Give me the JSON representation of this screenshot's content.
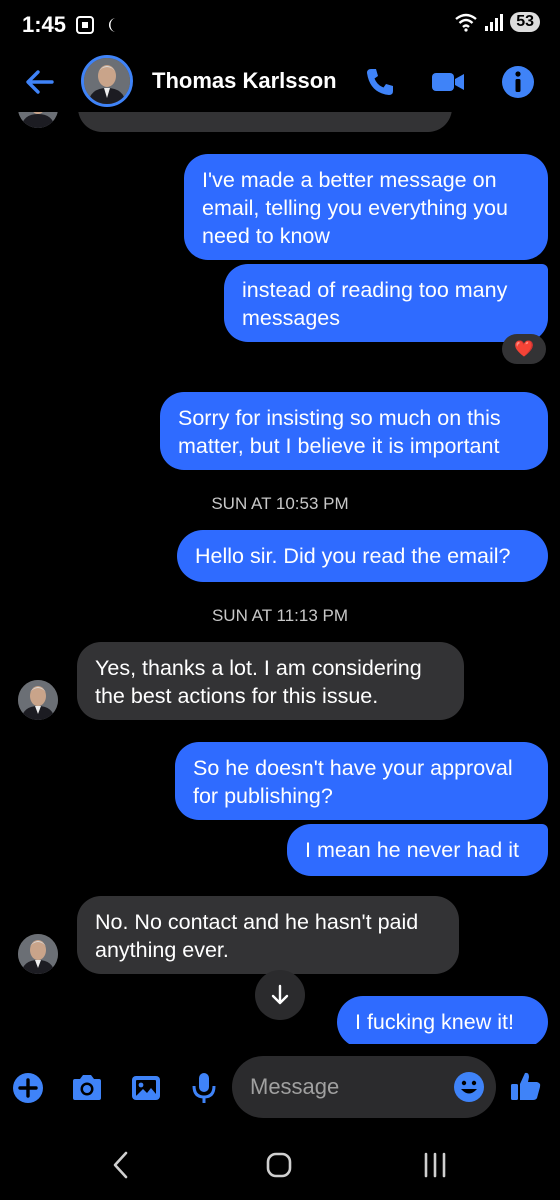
{
  "status_bar": {
    "time": "1:45",
    "battery": "53",
    "icons": [
      "screenshot-icon",
      "do-not-disturb-moon-icon",
      "wifi-icon",
      "signal-icon",
      "battery-icon"
    ]
  },
  "header": {
    "contact_name": "Thomas Karlsson",
    "icons": [
      "back-arrow-icon",
      "phone-icon",
      "video-camera-icon",
      "info-icon"
    ]
  },
  "messages": [
    {
      "id": "m1",
      "direction": "outgoing",
      "text": "I've made a better message on email, telling you everything you need to know"
    },
    {
      "id": "m2",
      "direction": "outgoing",
      "text": "instead of reading too many messages",
      "reaction": "❤️"
    },
    {
      "id": "m3",
      "direction": "outgoing",
      "text": "Sorry for insisting so much on this matter, but I believe it is important"
    },
    {
      "id": "t1",
      "type": "timestamp",
      "text": "SUN AT 10:53 PM"
    },
    {
      "id": "m4",
      "direction": "outgoing",
      "text": "Hello sir. Did you read the email?"
    },
    {
      "id": "t2",
      "type": "timestamp",
      "text": "SUN AT 11:13 PM"
    },
    {
      "id": "m5",
      "direction": "incoming",
      "text": "Yes, thanks a lot. I am considering the best actions for this issue."
    },
    {
      "id": "m6",
      "direction": "outgoing",
      "text": "So he doesn't have your approval for publishing?"
    },
    {
      "id": "m7",
      "direction": "outgoing",
      "text": "I mean he never had it"
    },
    {
      "id": "m8",
      "direction": "incoming",
      "text": "No. No contact and he hasn't paid anything ever."
    },
    {
      "id": "m9",
      "direction": "outgoing",
      "text": "I fucking knew it!"
    }
  ],
  "composer": {
    "placeholder": "Message",
    "icons": [
      "plus-icon",
      "camera-icon",
      "gallery-icon",
      "microphone-icon",
      "emoji-icon",
      "thumbs-up-icon"
    ]
  },
  "colors": {
    "accent": "#2f6bff",
    "icon_blue": "#3f83f8",
    "incoming_bubble": "#333335",
    "background": "#000000"
  }
}
